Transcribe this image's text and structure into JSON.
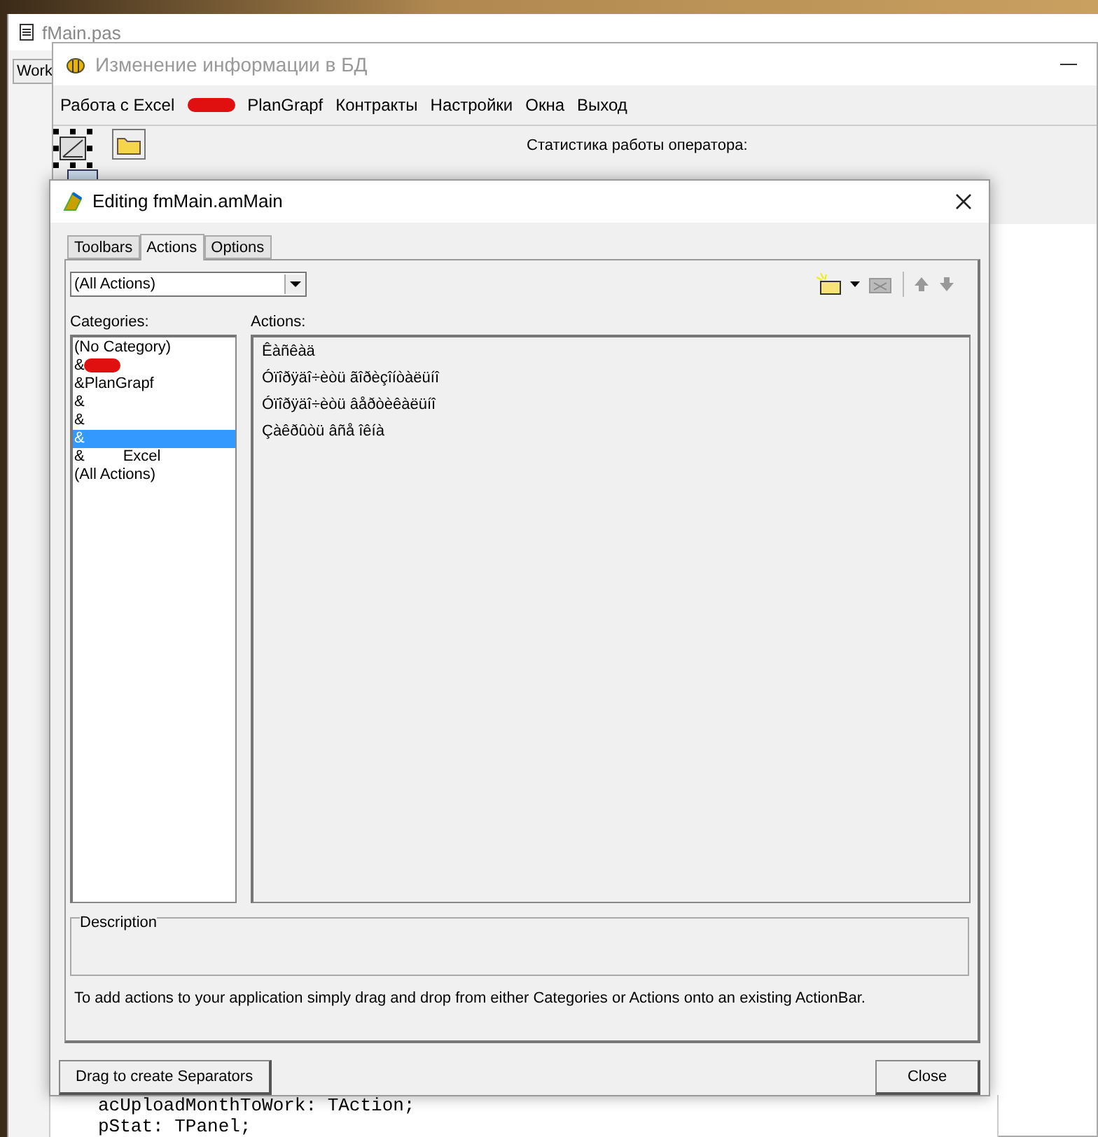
{
  "ide": {
    "title": "fMain.pas",
    "tab": "Work",
    "code_lines": [
      "acUploadMonthToWork: TAction;",
      "pStat: TPanel;"
    ]
  },
  "form": {
    "title": "Изменение информации в БД",
    "menu": [
      {
        "kind": "text",
        "label": "Работа с Excel"
      },
      {
        "kind": "redacted"
      },
      {
        "kind": "text",
        "label": "PlanGrapf"
      },
      {
        "kind": "text",
        "label": "Контракты"
      },
      {
        "kind": "text",
        "label": "Настройки"
      },
      {
        "kind": "text",
        "label": "Окна"
      },
      {
        "kind": "text",
        "label": "Выход"
      }
    ],
    "status_label": "Статистика работы оператора:"
  },
  "dialog": {
    "title": "Editing fmMain.amMain",
    "tabs": [
      {
        "label": "Toolbars",
        "selected": false
      },
      {
        "label": "Actions",
        "selected": true
      },
      {
        "label": "Options",
        "selected": false
      }
    ],
    "filter": "(All Actions)",
    "categories_label": "Categories:",
    "categories": [
      {
        "label": "(No Category)",
        "redacted": false,
        "selected": false
      },
      {
        "label": "&",
        "redacted": true,
        "selected": false
      },
      {
        "label": "&PlanGrapf",
        "redacted": false,
        "selected": false
      },
      {
        "label": "&",
        "redacted": false,
        "selected": false
      },
      {
        "label": "&",
        "redacted": false,
        "selected": false
      },
      {
        "label": "&",
        "redacted": false,
        "selected": true
      },
      {
        "label": "&         Excel",
        "redacted": false,
        "selected": false
      },
      {
        "label": "(All Actions)",
        "redacted": false,
        "selected": false
      }
    ],
    "actions_label": "Actions:",
    "actions": [
      "Êàñêàä",
      "Óïîðÿäî÷èòü ãîðèçîíòàëüíî",
      "Óïîðÿäî÷èòü âåðòèêàëüíî",
      "Çàêðûòü âñå îêíà"
    ],
    "description_label": "Description",
    "hint": "To add actions to your application simply drag and drop from either Categories or Actions onto an existing ActionBar.",
    "buttons": [
      {
        "kind": "separator",
        "label": "Drag to create Separators"
      },
      {
        "kind": "close",
        "label": "Close"
      }
    ]
  }
}
